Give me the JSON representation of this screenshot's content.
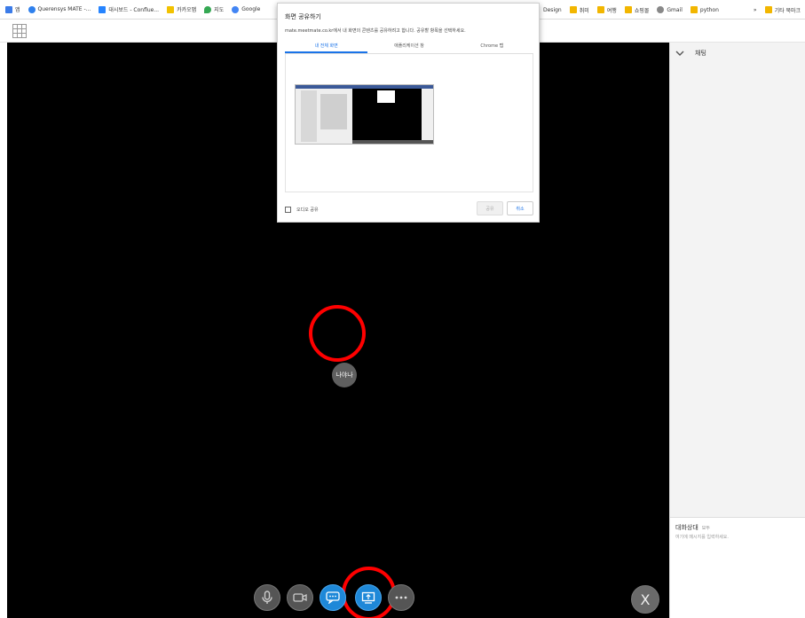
{
  "bookmarks": {
    "apps_label": "앱",
    "items": [
      {
        "label": "Querensys MATE -...",
        "color": "#2f80ed"
      },
      {
        "label": "대시보드 - Conflue...",
        "color": "#2684ff"
      },
      {
        "label": "카카오맵",
        "color": "#f2c200"
      },
      {
        "label": "지도",
        "color": "#34a853"
      },
      {
        "label": "Google",
        "color": "#4285f4"
      }
    ],
    "right_items": [
      {
        "label": "Design",
        "color": "#f2b600"
      },
      {
        "label": "취미",
        "color": "#f2b600"
      },
      {
        "label": "여행",
        "color": "#f2b600"
      },
      {
        "label": "쇼핑몰",
        "color": "#f2b600"
      },
      {
        "label": "Gmail",
        "color": "#888888"
      },
      {
        "label": "python",
        "color": "#f2b600"
      }
    ],
    "more": "»",
    "other_label": "기타 북마크"
  },
  "dialog": {
    "title": "화면 공유하기",
    "description": "mate.meetmate.co.kr에서 내 화면의 콘텐츠를 공유하려고 합니다. 공유할 항목을 선택하세요.",
    "tabs": [
      "내 전체 화면",
      "애플리케이션 창",
      "Chrome 탭"
    ],
    "active_tab": 0,
    "audio_label": "오디오 공유",
    "share_label": "공유",
    "cancel_label": "취소"
  },
  "video": {
    "participant_label": "나야나"
  },
  "controls": [
    {
      "name": "microphone-button",
      "icon": "mic-icon",
      "style": "gray"
    },
    {
      "name": "camera-button",
      "icon": "video-camera-icon",
      "style": "gray"
    },
    {
      "name": "chat-button",
      "icon": "chat-bubble-icon",
      "style": "blue"
    },
    {
      "name": "screen-share-button",
      "icon": "screen-share-icon",
      "style": "blue"
    },
    {
      "name": "more-button",
      "icon": "more-dots-icon",
      "style": "gray"
    }
  ],
  "leave_label": "X",
  "chat": {
    "header": "채팅",
    "partner_label": "대화상대",
    "partner_sub": "모두",
    "placeholder": "여기에 메시지를 입력하세요."
  },
  "colors": {
    "accent": "#1a73e8",
    "highlight_ring": "#ff0000",
    "video_bg": "#000000"
  }
}
